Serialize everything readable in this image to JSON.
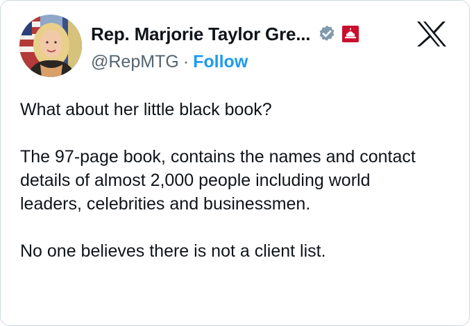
{
  "author": {
    "display_name": "Rep. Marjorie Taylor Gre...",
    "handle": "@RepMTG",
    "separator": "·",
    "follow_label": "Follow"
  },
  "badges": {
    "verified_icon": "verified-badge-icon",
    "affiliation_icon": "government-affiliation-icon"
  },
  "platform_logo": "x-logo-icon",
  "tweet": {
    "paragraphs": [
      "What about her little black book?",
      "The 97-page book, contains the names and contact details of almost 2,000 people including world leaders, celebrities and businessmen.",
      "No one believes there is not a client list."
    ]
  },
  "colors": {
    "link_blue": "#1d9bf0",
    "text": "#0f1419",
    "secondary_text": "#536471",
    "verified_gray": "#829aab",
    "affiliation_red": "#c8102e",
    "border": "#cfd9de"
  }
}
